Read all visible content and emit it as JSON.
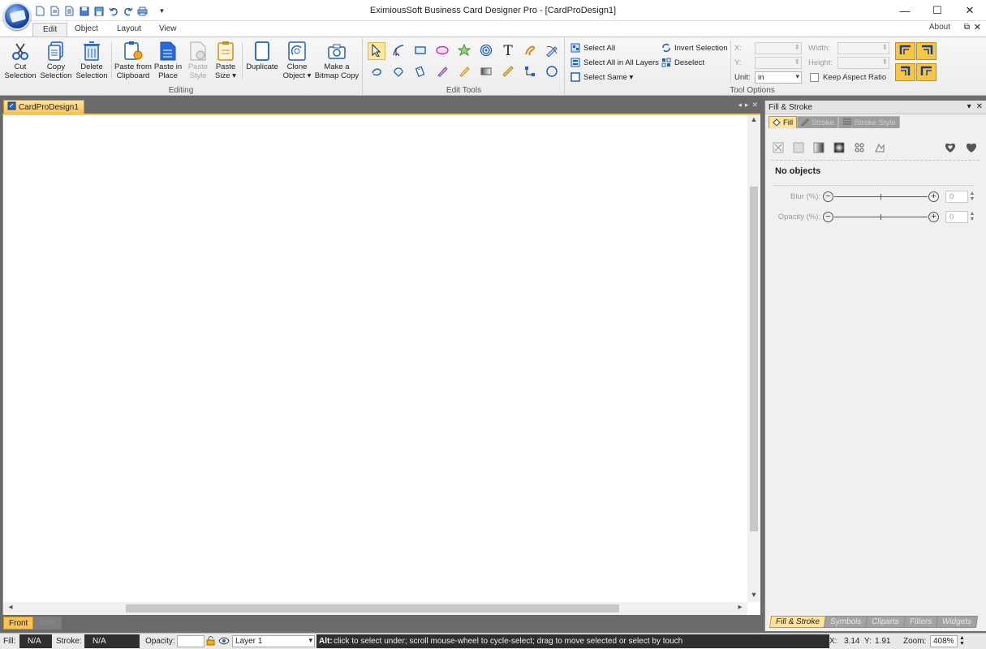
{
  "window": {
    "title": "EximiousSoft Business Card Designer Pro - [CardProDesign1]",
    "minimize": "—",
    "maximize": "☐",
    "close": "✕"
  },
  "qat_icons": [
    "new-icon",
    "open-icon",
    "template-icon",
    "save-icon",
    "save-as-icon",
    "undo-icon",
    "redo-icon",
    "print-icon",
    "customize-icon"
  ],
  "ribbon": {
    "tabs": [
      {
        "label": "Edit",
        "active": true
      },
      {
        "label": "Object",
        "active": false
      },
      {
        "label": "Layout",
        "active": false
      },
      {
        "label": "View",
        "active": false
      }
    ],
    "about": "About",
    "groups": {
      "editing": {
        "label": "Editing",
        "buttons": [
          {
            "l1": "Cut",
            "l2": "Selection"
          },
          {
            "l1": "Copy",
            "l2": "Selection"
          },
          {
            "l1": "Delete",
            "l2": "Selection"
          },
          {
            "l1": "Paste from",
            "l2": "Clipboard"
          },
          {
            "l1": "Paste in",
            "l2": "Place"
          },
          {
            "l1": "Paste",
            "l2": "Style"
          },
          {
            "l1": "Paste",
            "l2": "Size ▾"
          },
          {
            "l1": "Duplicate",
            "l2": ""
          },
          {
            "l1": "Clone",
            "l2": "Object ▾"
          },
          {
            "l1": "Make a",
            "l2": "Bitmap Copy"
          }
        ]
      },
      "edit_tools": {
        "label": "Edit Tools"
      },
      "selection": {
        "select_all": "Select All",
        "select_all_layers": "Select All in All Layers",
        "select_same": "Select Same ▾",
        "invert": "Invert Selection",
        "deselect": "Deselect"
      },
      "tool_options": {
        "label": "Tool Options",
        "x": "X:",
        "y": "Y:",
        "width": "Width:",
        "height": "Height:",
        "unit_label": "Unit:",
        "unit_value": "in",
        "keep_aspect": "Keep Aspect Ratio"
      }
    }
  },
  "document": {
    "tab": "CardProDesign1",
    "page_tabs": [
      "Front",
      "Back"
    ]
  },
  "panel": {
    "title": "Fill & Stroke",
    "tabs": [
      "Fill",
      "Stroke",
      "Stroke Style"
    ],
    "no_objects": "No objects",
    "blur_label": "Blur (%):",
    "blur_value": "0",
    "opacity_label": "Opacity (%):",
    "opacity_value": "0",
    "bottom_tabs": [
      "Fill & Stroke",
      "Symbols",
      "Cliparts",
      "Filters",
      "Widgets"
    ]
  },
  "status": {
    "fill_label": "Fill:",
    "fill_value": "N/A",
    "stroke_label": "Stroke:",
    "stroke_value": "N/A",
    "opacity_label": "Opacity:",
    "layer": "Layer 1",
    "hint_bold": "Alt:",
    "hint": "click to select under; scroll mouse-wheel to cycle-select; drag to move selected or select by touch",
    "x_label": "X:",
    "x_value": "3.14",
    "y_label": "Y:",
    "y_value": "1.91",
    "zoom_label": "Zoom:",
    "zoom_value": "408%"
  }
}
